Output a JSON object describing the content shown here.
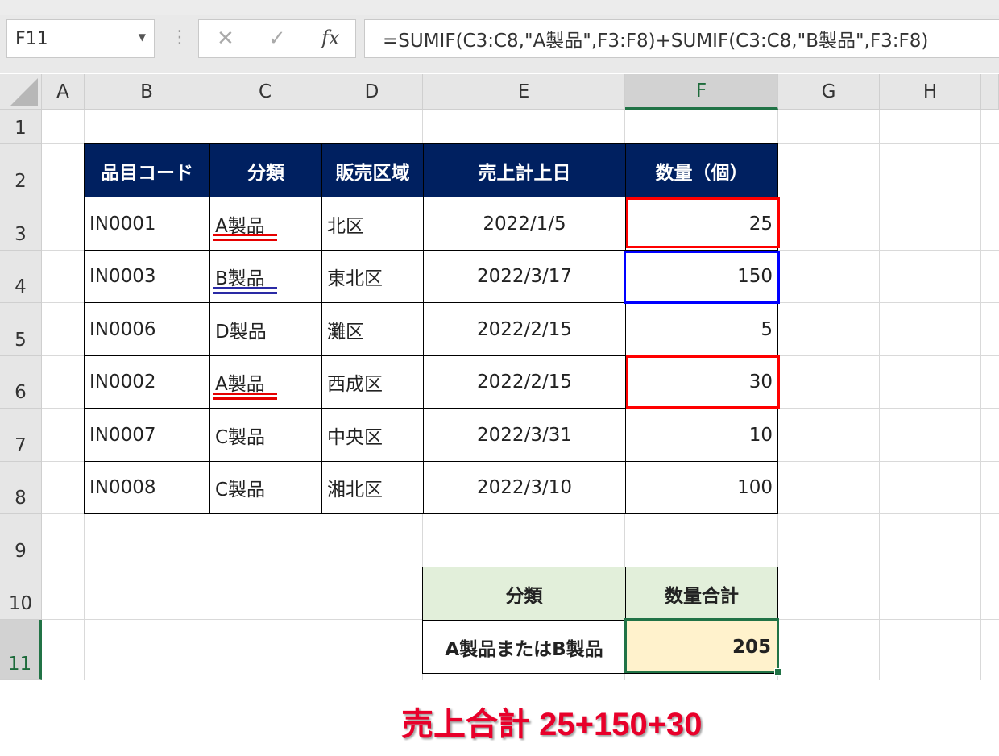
{
  "formula_bar": {
    "name_box": "F11",
    "formula": "=SUMIF(C3:C8,\"A製品\",F3:F8)+SUMIF(C3:C8,\"B製品\",F3:F8)",
    "cancel_icon": "close-icon",
    "enter_icon": "check-icon",
    "fx_label": "fx"
  },
  "columns": [
    "A",
    "B",
    "C",
    "D",
    "E",
    "F",
    "G",
    "H"
  ],
  "rows": [
    "1",
    "2",
    "3",
    "4",
    "5",
    "6",
    "7",
    "8",
    "9",
    "10",
    "11"
  ],
  "selected": {
    "column": "F",
    "row": "11"
  },
  "table": {
    "headers": [
      "品目コード",
      "分類",
      "販売区域",
      "売上計上日",
      "数量（個）"
    ],
    "rows": [
      [
        "IN0001",
        "A製品",
        "北区",
        "2022/1/5",
        "25"
      ],
      [
        "IN0003",
        "B製品",
        "東北区",
        "2022/3/17",
        "150"
      ],
      [
        "IN0006",
        "D製品",
        "灘区",
        "2022/2/15",
        "5"
      ],
      [
        "IN0002",
        "A製品",
        "西成区",
        "2022/2/15",
        "30"
      ],
      [
        "IN0007",
        "C製品",
        "中央区",
        "2022/3/31",
        "10"
      ],
      [
        "IN0008",
        "C製品",
        "湘北区",
        "2022/3/10",
        "100"
      ]
    ]
  },
  "summary": {
    "header_category": "分類",
    "header_total": "数量合計",
    "category": "A製品またはB製品",
    "total": "205"
  },
  "caption": "売上合計  25+150+30",
  "colors": {
    "header_bg": "#002060",
    "summary_header_bg": "#e2efda",
    "total_bg": "#fff2cc",
    "highlight_a": "#ff0000",
    "highlight_b": "#0000ff",
    "selection": "#217346",
    "caption": "#e8002a"
  }
}
